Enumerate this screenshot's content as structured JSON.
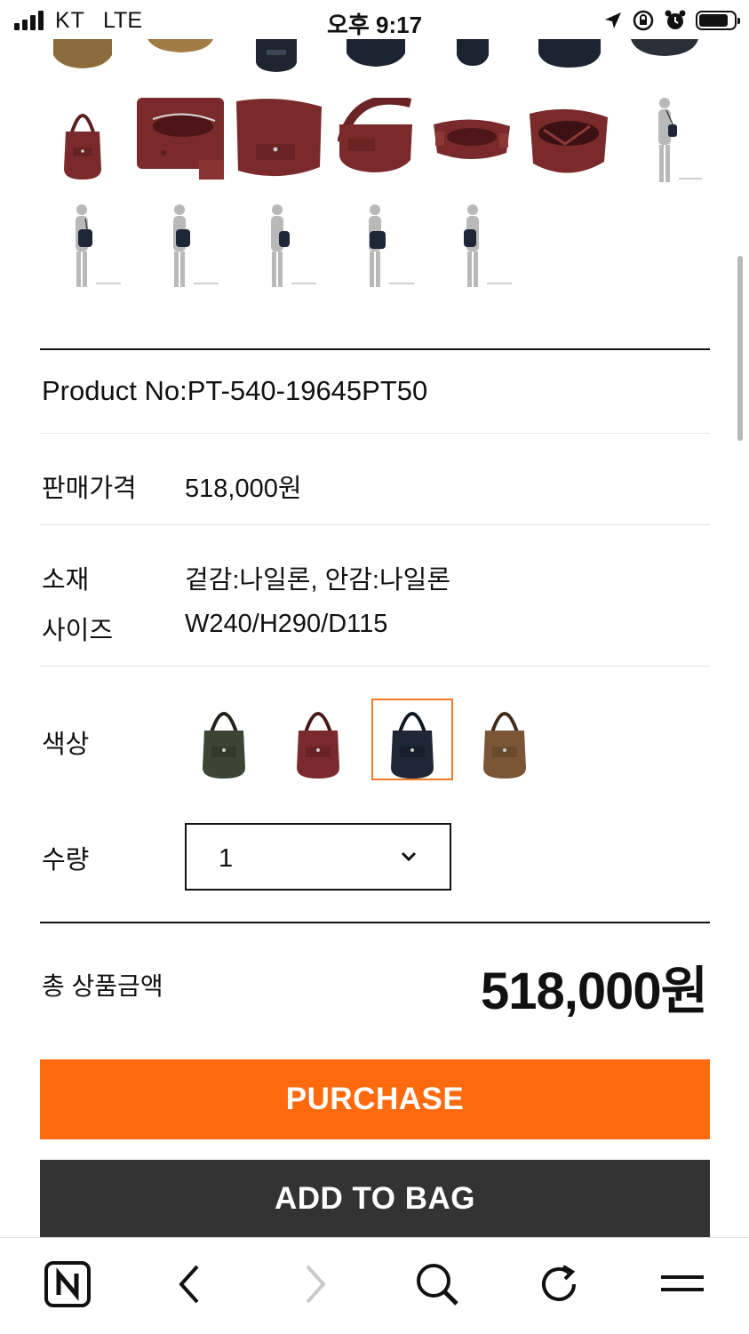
{
  "status_bar": {
    "carrier": "KT",
    "network": "LTE",
    "time": "오후 9:17"
  },
  "gallery": {
    "row1_colors": [
      "#8b6b3a",
      "#a17b44",
      "#1f2530",
      "#1d2431",
      "#1b2230",
      "#1d2431",
      "#2a2f38"
    ],
    "row2_items": [
      "bag-burgundy-front",
      "bag-burgundy-open",
      "bag-burgundy-side",
      "bag-burgundy-back",
      "bag-burgundy-top",
      "bag-burgundy-inside",
      "model-side"
    ],
    "row3_items": [
      "model-front",
      "model-back",
      "model-side",
      "model-front",
      "model-side"
    ],
    "bag_color": "#7a2a2a"
  },
  "product": {
    "product_no": "Product No:PT-540-19645PT50",
    "price_label": "판매가격",
    "price_value": "518,000원",
    "material_label": "소재",
    "material_value": "겉감:나일론, 안감:나일론",
    "size_label": "사이즈",
    "size_value": "W240/H290/D115"
  },
  "options": {
    "color_label": "색상",
    "colors": [
      {
        "name": "olive",
        "hex": "#3c4434",
        "selected": false
      },
      {
        "name": "burgundy",
        "hex": "#7a2a2c",
        "selected": false
      },
      {
        "name": "navy",
        "hex": "#1f2636",
        "selected": true
      },
      {
        "name": "brown",
        "hex": "#7a5636",
        "selected": false
      }
    ],
    "quantity_label": "수량",
    "quantity_value": "1"
  },
  "total": {
    "label": "총 상품금액",
    "value": "518,000원"
  },
  "actions": {
    "purchase_label": "PURCHASE",
    "add_to_bag_label": "ADD TO BAG"
  },
  "theme": {
    "accent": "#ff6a0e",
    "dark_button": "#333333",
    "selected_border": "#ef7a2a"
  },
  "browser_nav": {
    "icons": [
      "naver-home-icon",
      "back-icon",
      "forward-icon",
      "search-icon",
      "refresh-icon",
      "menu-icon"
    ]
  }
}
